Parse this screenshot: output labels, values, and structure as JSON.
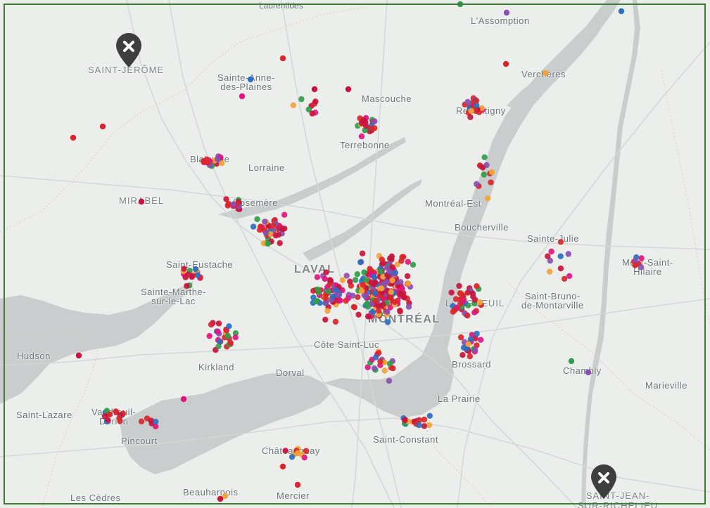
{
  "labels": {
    "laurentides": "Laurentides",
    "lassomption": "L'Assomption",
    "saint_jerome": "SAINT-JÉRÔME",
    "sainte_anne": "Sainte-Anne-\ndes-Plaines",
    "mascouche": "Mascouche",
    "vercheres": "Verchères",
    "repentigny": "Repentigny",
    "terrebonne": "Terrebonne",
    "blainville": "Blainville",
    "lorraine": "Lorraine",
    "mirabel": "MIRABEL",
    "rosemere": "Rosemère",
    "montreal_est": "Montréal-Est",
    "boucherville": "Boucherville",
    "sainte_julie": "Sainte-Julie",
    "mont_saint_hilaire": "Mont-Saint-\nHilaire",
    "saint_eustache": "Saint-Eustache",
    "laval": "LAVAL",
    "sainte_marthe": "Sainte-Marthe-\nsur-le-Lac",
    "saint_bruno": "Saint-Bruno-\nde-Montarville",
    "longueuil": "LONGUEUIL",
    "montreal": "MONTRÉAL",
    "hudson": "Hudson",
    "cote_saint_luc": "Côte Saint-Luc",
    "kirkland": "Kirkland",
    "dorval": "Dorval",
    "brossard": "Brossard",
    "chambly": "Chambly",
    "marieville": "Marieville",
    "saint_lazare": "Saint-Lazare",
    "vaudreuil": "Vaudreuil-\nDorion",
    "la_prairie": "La Prairie",
    "pincourt": "Pincourt",
    "saint_constant": "Saint-Constant",
    "chateauguay": "Châteauguay",
    "beauharnois": "Beauharnois",
    "les_cedres": "Les Cèdres",
    "mercier": "Mercier",
    "saint_jean": "SAINT-JEAN-\nSUR-RICHELIEU"
  },
  "markers": {
    "saint_jerome_pin_icon": "close-marker-icon",
    "saint_jean_pin_icon": "close-marker-icon"
  },
  "colors": {
    "water": "#c9cdcd",
    "land": "#eceeec",
    "bbox": "#3e7b32",
    "dot_red": "#d9262a",
    "dot_crimson": "#c8143c",
    "dot_pink": "#e0157f",
    "dot_blue": "#2a6fc0",
    "dot_green": "#2f9e48",
    "dot_purple": "#8a4fb2",
    "dot_orange": "#f2a43a",
    "pin": "#3e3e3e"
  }
}
